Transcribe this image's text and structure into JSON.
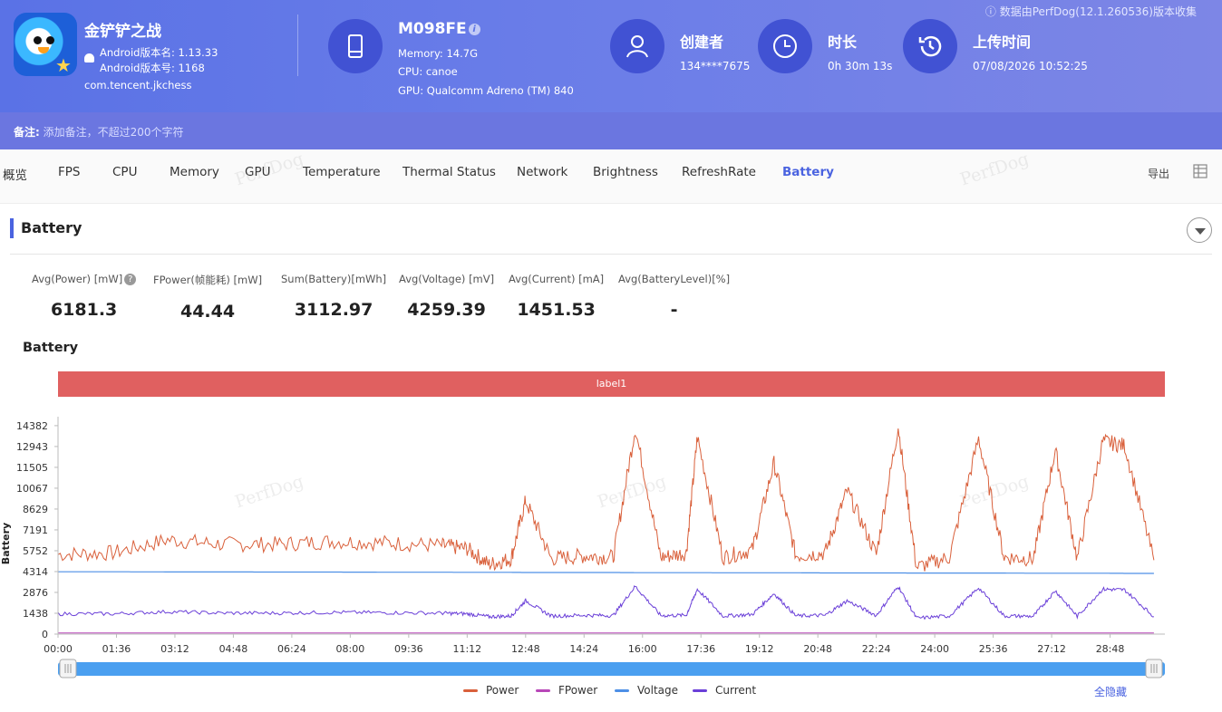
{
  "header": {
    "app_name": "金铲铲之战",
    "android_version_name": "Android版本名: 1.13.33",
    "android_version_code": "Android版本号: 1168",
    "package": "com.tencent.jkchess",
    "device": {
      "model": "M098FE",
      "memory": "Memory: 14.7G",
      "cpu": "CPU: canoe",
      "gpu": "GPU: Qualcomm Adreno (TM) 840"
    },
    "creator_label": "创建者",
    "creator_value": "134****7675",
    "duration_label": "时长",
    "duration_value": "0h 30m 13s",
    "upload_label": "上传时间",
    "upload_value": "07/08/2026 10:52:25",
    "source_note": "ⓘ 数据由PerfDog(12.1.260536)版本收集"
  },
  "note": {
    "label": "备注:",
    "placeholder": "添加备注，不超过200个字符"
  },
  "tabs": [
    "概览",
    "FPS",
    "CPU",
    "Memory",
    "GPU",
    "Temperature",
    "Thermal Status",
    "Network",
    "Brightness",
    "RefreshRate",
    "Battery"
  ],
  "active_tab": "Battery",
  "export_label": "导出",
  "section_title": "Battery",
  "stats": [
    {
      "label": "Avg(Power) [mW]",
      "value": "6181.3"
    },
    {
      "label": "FPower(帧能耗) [mW]",
      "value": "44.44"
    },
    {
      "label": "Sum(Battery)[mWh]",
      "value": "3112.97"
    },
    {
      "label": "Avg(Voltage) [mV]",
      "value": "4259.39"
    },
    {
      "label": "Avg(Current) [mA]",
      "value": "1451.53"
    },
    {
      "label": "Avg(BatteryLevel)[%]",
      "value": "-"
    }
  ],
  "chart_title": "Battery",
  "label_bar": "label1",
  "watermark": "PerfDog",
  "legend": [
    {
      "name": "Power",
      "color": "#d9603b"
    },
    {
      "name": "FPower",
      "color": "#b847b8"
    },
    {
      "name": "Voltage",
      "color": "#4d8fe6"
    },
    {
      "name": "Current",
      "color": "#6a3fd8"
    }
  ],
  "hide_all": "全隐藏",
  "chart_data": {
    "type": "line",
    "ylabel": "Battery",
    "ylim": [
      0,
      15000
    ],
    "yticks": [
      0,
      1438,
      2876,
      4314,
      5752,
      7191,
      8629,
      10067,
      11505,
      12943,
      14382
    ],
    "xticks": [
      "00:00",
      "01:36",
      "03:12",
      "04:48",
      "06:24",
      "08:00",
      "09:36",
      "11:12",
      "12:48",
      "14:24",
      "16:00",
      "17:36",
      "19:12",
      "20:48",
      "22:24",
      "24:00",
      "25:36",
      "27:12",
      "28:48"
    ],
    "x_minutes": [
      0,
      1.5,
      3,
      4.5,
      6,
      7.5,
      9,
      10.5,
      11.2,
      11.8,
      12.4,
      12.8,
      13.5,
      14.4,
      15.2,
      15.8,
      16.5,
      17.2,
      17.5,
      18.2,
      19.0,
      19.6,
      20.2,
      21.0,
      21.6,
      22.4,
      23.0,
      23.5,
      24.4,
      25.2,
      25.9,
      26.7,
      27.3,
      27.9,
      28.6,
      29.2,
      30.0
    ],
    "series": [
      {
        "name": "Power",
        "values": [
          5500,
          5600,
          6500,
          6200,
          6200,
          6400,
          6300,
          6100,
          5900,
          4800,
          5200,
          9200,
          5200,
          5400,
          5300,
          14200,
          5300,
          5600,
          13600,
          5300,
          5800,
          11800,
          5400,
          5600,
          9900,
          5500,
          14300,
          4600,
          5300,
          13500,
          5300,
          5200,
          12700,
          5200,
          13300,
          13000,
          5100
        ]
      },
      {
        "name": "FPower",
        "values": [
          80,
          80,
          80,
          80,
          80,
          80,
          80,
          80,
          80,
          80,
          80,
          80,
          80,
          80,
          80,
          80,
          80,
          80,
          80,
          80,
          80,
          80,
          80,
          80,
          80,
          80,
          80,
          80,
          80,
          80,
          80,
          80,
          80,
          80,
          80,
          80,
          80
        ]
      },
      {
        "name": "Voltage",
        "values": [
          4300,
          4300,
          4290,
          4290,
          4280,
          4280,
          4270,
          4270,
          4260,
          4260,
          4260,
          4250,
          4250,
          4250,
          4250,
          4240,
          4240,
          4240,
          4240,
          4230,
          4230,
          4230,
          4230,
          4220,
          4220,
          4220,
          4220,
          4210,
          4210,
          4210,
          4210,
          4200,
          4200,
          4200,
          4200,
          4190,
          4190
        ]
      },
      {
        "name": "Current",
        "values": [
          1400,
          1400,
          1550,
          1450,
          1450,
          1500,
          1480,
          1450,
          1400,
          1200,
          1250,
          2300,
          1250,
          1300,
          1280,
          3300,
          1280,
          1300,
          3100,
          1250,
          1350,
          2800,
          1250,
          1300,
          2300,
          1280,
          3300,
          1100,
          1250,
          3200,
          1250,
          1230,
          3000,
          1230,
          3100,
          3050,
          1200
        ]
      }
    ]
  }
}
